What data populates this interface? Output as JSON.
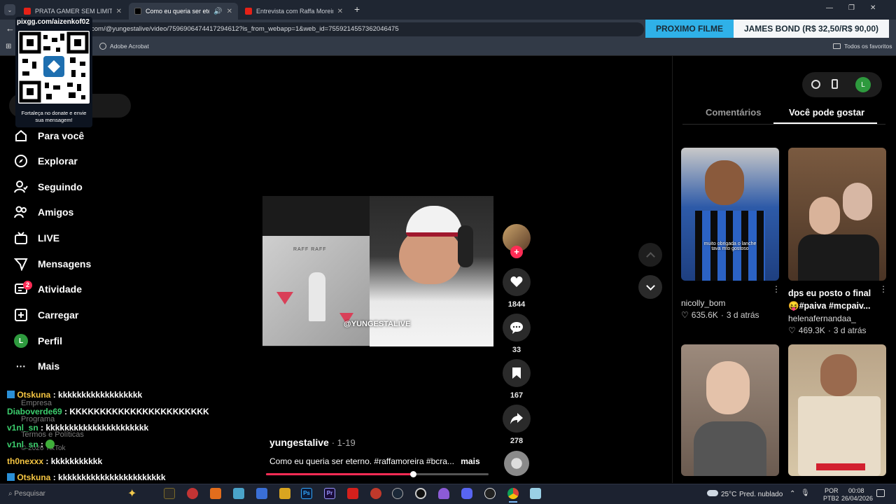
{
  "browser": {
    "tabs": [
      {
        "title": "PRATA GAMER SEM LIMITES - Y",
        "close": "✕"
      },
      {
        "title": "Como eu queria ser eterno",
        "close": "✕"
      },
      {
        "title": "Entrevista com Raffa Moreira -",
        "close": "✕"
      }
    ],
    "new_tab": "+",
    "url": "com/@yungestalive/video/7596906474417294612?is_from_webapp=1&web_id=7559214557362046475",
    "bookmark": "Adobe Acrobat",
    "all_bookmarks": "Todos os favoritos"
  },
  "overlay": {
    "banner_label": "PROXIMO FILME",
    "banner_value": "JAMES BOND (R$ 32,50/R$ 90,00)",
    "qr_url": "pixgg.com/aizenkof02",
    "qr_caption": "Fortaleça no donate e envie sua mensagem!"
  },
  "sidebar": {
    "items": [
      {
        "label": "Para você",
        "icon": "home-icon"
      },
      {
        "label": "Explorar",
        "icon": "compass-icon"
      },
      {
        "label": "Seguindo",
        "icon": "following-icon"
      },
      {
        "label": "Amigos",
        "icon": "friends-icon"
      },
      {
        "label": "LIVE",
        "icon": "live-icon"
      },
      {
        "label": "Mensagens",
        "icon": "messages-icon"
      },
      {
        "label": "Atividade",
        "icon": "activity-icon",
        "badge": "2"
      },
      {
        "label": "Carregar",
        "icon": "upload-icon"
      },
      {
        "label": "Perfil",
        "icon": "profile-avatar",
        "avatar_letter": "L"
      },
      {
        "label": "Mais",
        "icon": "more-icon"
      }
    ],
    "footer": [
      "Empresa",
      "Programa",
      "Termos e Políticas",
      "© 2026 TikTok"
    ]
  },
  "chat": [
    {
      "user": "Otskuna",
      "msg": "kkkkkkkkkkkkkkkkkk",
      "color": "#f5c542",
      "badge": true
    },
    {
      "user": "Diaboverde69",
      "msg": "KKKKKKKKKKKKKKKKKKKKKKK",
      "color": "#3ccf6e",
      "badge": false
    },
    {
      "user": "v1nl_sn",
      "msg": "kkkkkkkkkkkkkkkkkkkkkk",
      "color": "#3ccf6e",
      "badge": false
    },
    {
      "user": "v1nl_sn",
      "msg": "",
      "color": "#3ccf6e",
      "badge": false,
      "emote": true
    },
    {
      "user": "th0nexxx",
      "msg": "kkkkkkkkkkk",
      "color": "#f5c542",
      "badge": false
    },
    {
      "user": "Otskuna",
      "msg": "kkkkkkkkkkkkkkkkkkkkkkk",
      "color": "#f5c542",
      "badge": true
    }
  ],
  "video": {
    "watermark": "@YUNGESTALIVE",
    "album_artist": "RAFF RAFF",
    "username": "yungestalive",
    "date": "· 1-19",
    "description": "Como eu queria ser eterno. #raffamoreira #bcra...",
    "more": "mais",
    "progress": 0.66,
    "likes": "1844",
    "comments": "33",
    "saves": "167",
    "shares": "278"
  },
  "right_panel": {
    "profile_letter": "L",
    "tabs": [
      "Comentários",
      "Você pode gostar"
    ],
    "active_tab": 1,
    "cards": [
      {
        "title": "",
        "caption": "muito obrigada o lanche tava mto gostoso",
        "user": "nicolly_bom",
        "views": "635.6K",
        "age": "3 d atrás",
        "bg": "#2d5aa8"
      },
      {
        "title": "dps eu posto o final 😝#paiva #mcpaiv...",
        "caption": "",
        "user": "helenafernandaa_",
        "views": "469.3K",
        "age": "3 d atrás",
        "bg": "#6b4a35"
      },
      {
        "title": "",
        "caption": "",
        "user": "",
        "views": "",
        "age": "",
        "bg": "#8a7a6e"
      },
      {
        "title": "",
        "caption": "",
        "user": "",
        "views": "",
        "age": "",
        "bg": "#b79a74"
      }
    ]
  },
  "taskbar": {
    "weather": "25°C",
    "weather_text": "Pred. nublado",
    "lang1": "POR",
    "lang2": "PTB2",
    "time": "00:08",
    "date": "26/04/2026",
    "search_text": "Pesquisar"
  }
}
